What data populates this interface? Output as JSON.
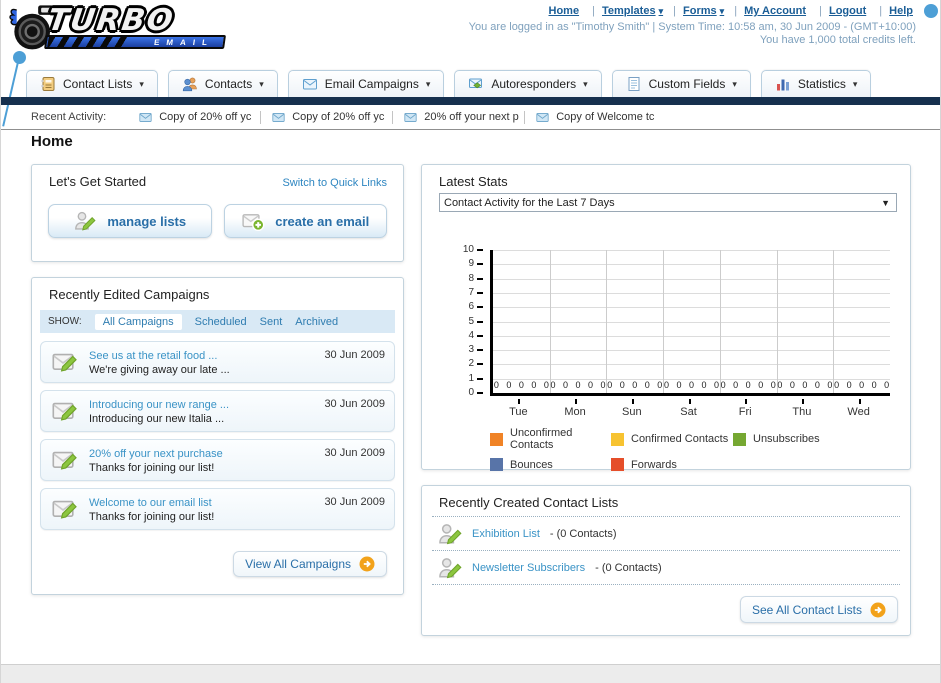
{
  "logo": {
    "brand_top": "TURBO",
    "brand_bottom": "EMAIL"
  },
  "header": {
    "links": [
      {
        "label": "Home",
        "arrow": ""
      },
      {
        "label": "Templates",
        "arrow": "▾"
      },
      {
        "label": "Forms",
        "arrow": "▾"
      },
      {
        "label": "My Account",
        "arrow": ""
      },
      {
        "label": "Logout",
        "arrow": ""
      },
      {
        "label": "Help",
        "arrow": ""
      }
    ],
    "login_status": "You are logged in as \"Timothy Smith\" | System Time: 10:58 am, 30 Jun 2009 - (GMT+10:00)",
    "credits_note": "You have 1,000 total credits left."
  },
  "nav": {
    "tabs": [
      {
        "label": "Contact Lists",
        "icon": "address-book-icon",
        "arrow": "▾"
      },
      {
        "label": "Contacts",
        "icon": "contacts-icon",
        "arrow": "▾"
      },
      {
        "label": "Email Campaigns",
        "icon": "email-campaign-icon",
        "arrow": "▾"
      },
      {
        "label": "Autoresponders",
        "icon": "autoresponder-icon",
        "arrow": "▾"
      },
      {
        "label": "Custom Fields",
        "icon": "custom-fields-icon",
        "arrow": "▾"
      },
      {
        "label": "Statistics",
        "icon": "statistics-icon",
        "arrow": "▾"
      }
    ]
  },
  "recent_activity": {
    "label": "Recent Activity:",
    "items": [
      {
        "label": "Copy of 20% off yc",
        "icon": "envelope-icon"
      },
      {
        "label": "Copy of 20% off yc",
        "icon": "envelope-icon"
      },
      {
        "label": "20% off your next p",
        "icon": "envelope-icon"
      },
      {
        "label": "Copy of Welcome tc",
        "icon": "envelope-icon"
      }
    ]
  },
  "page_title": "Home",
  "lets_get_started": {
    "title": "Let's Get Started",
    "switch_link": "Switch to Quick Links",
    "buttons": [
      {
        "label": "manage lists",
        "icon": "list-edit-icon"
      },
      {
        "label": "create an email",
        "icon": "email-plus-icon"
      }
    ]
  },
  "campaigns": {
    "title": "Recently Edited Campaigns",
    "show_label": "SHOW:",
    "filters": [
      {
        "label": "All Campaigns",
        "state": "selected"
      },
      {
        "label": "Scheduled",
        "state": ""
      },
      {
        "label": "Sent",
        "state": ""
      },
      {
        "label": "Archived",
        "state": ""
      }
    ],
    "items": [
      {
        "title": "See us at the retail food ...",
        "subtitle": "We're giving away our late ...",
        "date": "30 Jun 2009",
        "icon": "campaign-edit-icon"
      },
      {
        "title": "Introducing our new range ...",
        "subtitle": "Introducing our new Italia ...",
        "date": "30 Jun 2009",
        "icon": "campaign-edit-icon"
      },
      {
        "title": "20% off your next purchase",
        "subtitle": "Thanks for joining our list!",
        "date": "30 Jun 2009",
        "icon": "campaign-edit-icon"
      },
      {
        "title": "Welcome to our email list",
        "subtitle": "Thanks for joining our list!",
        "date": "30 Jun 2009",
        "icon": "campaign-edit-icon"
      }
    ],
    "view_all_label": "View All Campaigns",
    "view_all_icon": "arrow-circle-icon"
  },
  "latest_stats": {
    "title": "Latest Stats",
    "range_selected": "Contact Activity for the Last 7 Days"
  },
  "chart_data": {
    "type": "bar",
    "title": "Contact Activity for the Last 7 Days",
    "categories": [
      "Tue",
      "Mon",
      "Sun",
      "Sat",
      "Fri",
      "Thu",
      "Wed"
    ],
    "series": [
      {
        "name": "Unconfirmed Contacts",
        "color": "#f08326",
        "values": [
          0,
          0,
          0,
          0,
          0,
          0,
          0
        ]
      },
      {
        "name": "Confirmed Contacts",
        "color": "#f7c331",
        "values": [
          0,
          0,
          0,
          0,
          0,
          0,
          0
        ]
      },
      {
        "name": "Unsubscribes",
        "color": "#76a832",
        "values": [
          0,
          0,
          0,
          0,
          0,
          0,
          0
        ]
      },
      {
        "name": "Bounces",
        "color": "#5874a8",
        "values": [
          0,
          0,
          0,
          0,
          0,
          0,
          0
        ]
      },
      {
        "name": "Forwards",
        "color": "#e54e2a",
        "values": [
          0,
          0,
          0,
          0,
          0,
          0,
          0
        ]
      }
    ],
    "xlabel": "",
    "ylabel": "",
    "ylim": [
      0,
      10
    ],
    "ytick_step": 1,
    "grid": true,
    "legend_position": "bottom"
  },
  "contact_lists": {
    "title": "Recently Created Contact Lists",
    "items": [
      {
        "name": "Exhibition List",
        "count": "- (0 Contacts)",
        "icon": "list-edit-icon"
      },
      {
        "name": "Newsletter Subscribers",
        "count": "- (0 Contacts)",
        "icon": "list-edit-icon"
      }
    ],
    "see_all_label": "See All Contact Lists",
    "see_all_icon": "arrow-circle-icon"
  },
  "colors": {
    "navy_bar": "#16304e",
    "link_blue": "#2e7cb0",
    "title_link": "#3a93c6",
    "status_text": "#7fa1bd",
    "button_text": "#2a6fa8",
    "arrow_button_orange": "#f2a21a",
    "decor_dot_blue": "#4d9fd6"
  }
}
